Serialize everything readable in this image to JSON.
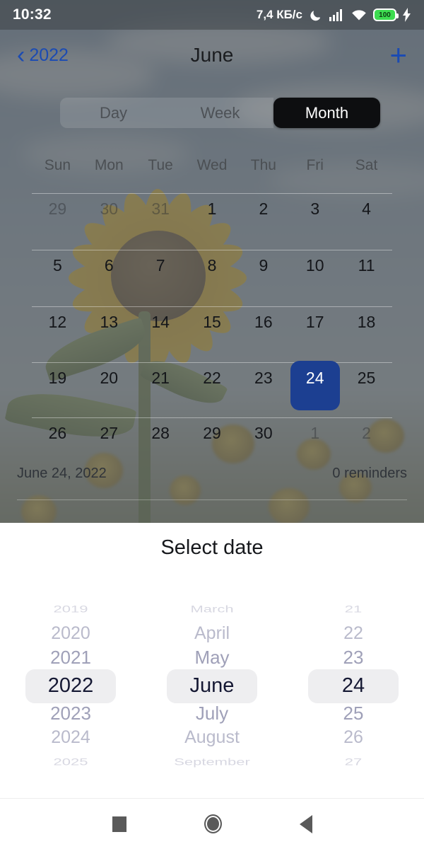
{
  "status_bar": {
    "time": "10:32",
    "network_speed": "7,4 КБ/с",
    "icons": [
      "moon-icon",
      "signal-icon",
      "wifi-icon",
      "battery-icon",
      "charging-bolt-icon"
    ],
    "battery_level": "100"
  },
  "nav_bar": {
    "back_chevron": "‹",
    "back_label": "2022",
    "title": "June",
    "add_label": "+",
    "accent_color": "#1b4bb3"
  },
  "segmented_control": {
    "options": [
      {
        "label": "Day",
        "active": false
      },
      {
        "label": "Week",
        "active": false
      },
      {
        "label": "Month",
        "active": true
      }
    ],
    "active_bg": "#0d0e10"
  },
  "calendar": {
    "weekdays": [
      "Sun",
      "Mon",
      "Tue",
      "Wed",
      "Thu",
      "Fri",
      "Sat"
    ],
    "weeks": [
      [
        {
          "n": "29",
          "muted": true
        },
        {
          "n": "30",
          "muted": true
        },
        {
          "n": "31",
          "muted": true
        },
        {
          "n": "1",
          "muted": false
        },
        {
          "n": "2",
          "muted": false
        },
        {
          "n": "3",
          "muted": false
        },
        {
          "n": "4",
          "muted": false
        }
      ],
      [
        {
          "n": "5",
          "muted": false
        },
        {
          "n": "6",
          "muted": false
        },
        {
          "n": "7",
          "muted": false
        },
        {
          "n": "8",
          "muted": false
        },
        {
          "n": "9",
          "muted": false
        },
        {
          "n": "10",
          "muted": false
        },
        {
          "n": "11",
          "muted": false
        }
      ],
      [
        {
          "n": "12",
          "muted": false
        },
        {
          "n": "13",
          "muted": false
        },
        {
          "n": "14",
          "muted": false
        },
        {
          "n": "15",
          "muted": false
        },
        {
          "n": "16",
          "muted": false
        },
        {
          "n": "17",
          "muted": false
        },
        {
          "n": "18",
          "muted": false
        }
      ],
      [
        {
          "n": "19",
          "muted": false
        },
        {
          "n": "20",
          "muted": false
        },
        {
          "n": "21",
          "muted": false
        },
        {
          "n": "22",
          "muted": false
        },
        {
          "n": "23",
          "muted": false
        },
        {
          "n": "24",
          "muted": false,
          "selected": true
        },
        {
          "n": "25",
          "muted": false
        }
      ],
      [
        {
          "n": "26",
          "muted": false
        },
        {
          "n": "27",
          "muted": false
        },
        {
          "n": "28",
          "muted": false
        },
        {
          "n": "29",
          "muted": false
        },
        {
          "n": "30",
          "muted": false
        },
        {
          "n": "1",
          "muted": true
        },
        {
          "n": "2",
          "muted": true
        }
      ]
    ],
    "selected_day": "24",
    "selected_color": "#1c3f91",
    "footer_date": "June 24, 2022",
    "footer_reminders": "0 reminders"
  },
  "sheet": {
    "title": "Select date",
    "highlight_color": "#eeeef0",
    "year_picker": {
      "items": [
        "2019",
        "2020",
        "2021",
        "2022",
        "2023",
        "2024",
        "2025"
      ],
      "selected": "2022"
    },
    "month_picker": {
      "items": [
        "March",
        "April",
        "May",
        "June",
        "July",
        "August",
        "September"
      ],
      "selected": "June"
    },
    "day_picker": {
      "items": [
        "21",
        "22",
        "23",
        "24",
        "25",
        "26",
        "27"
      ],
      "selected": "24"
    }
  },
  "system_nav": {
    "recents": "recents-square-icon",
    "home": "home-circle-icon",
    "back": "back-triangle-icon"
  }
}
